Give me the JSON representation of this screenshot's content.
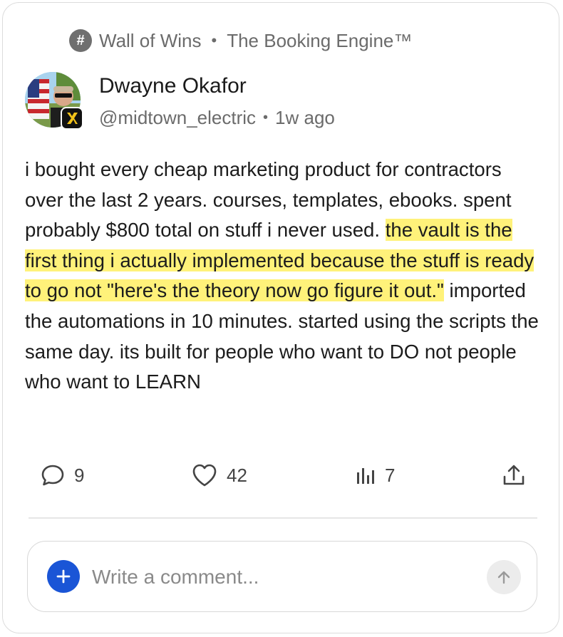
{
  "channel": {
    "icon": "hash-icon",
    "name": "Wall of Wins",
    "separator": "•",
    "community": "The Booking Engine™"
  },
  "author": {
    "name": "Dwayne Okafor",
    "handle": "@midtown_electric",
    "separator": "•",
    "time": "1w ago",
    "badge_icon": "lightning-badge-icon"
  },
  "post": {
    "text_before": "i bought every cheap marketing product for contractors over the last 2 years. courses, templates, ebooks. spent probably $800 total on stuff i never used. ",
    "text_highlight": "the vault is the first thing i actually implemented because the stuff is ready to go not \"here's the theory now go figure it out.\"",
    "text_after": " imported the automations in 10 minutes. started using the scripts the same day. its built for people who want to DO not people who want to LEARN",
    "highlight_color": "#fff27a"
  },
  "actions": {
    "comments": "9",
    "likes": "42",
    "views": "7",
    "icons": [
      "comment-icon",
      "heart-icon",
      "views-icon",
      "share-icon"
    ]
  },
  "composer": {
    "placeholder": "Write a comment...",
    "value": "",
    "accent": "#1a55d6"
  }
}
